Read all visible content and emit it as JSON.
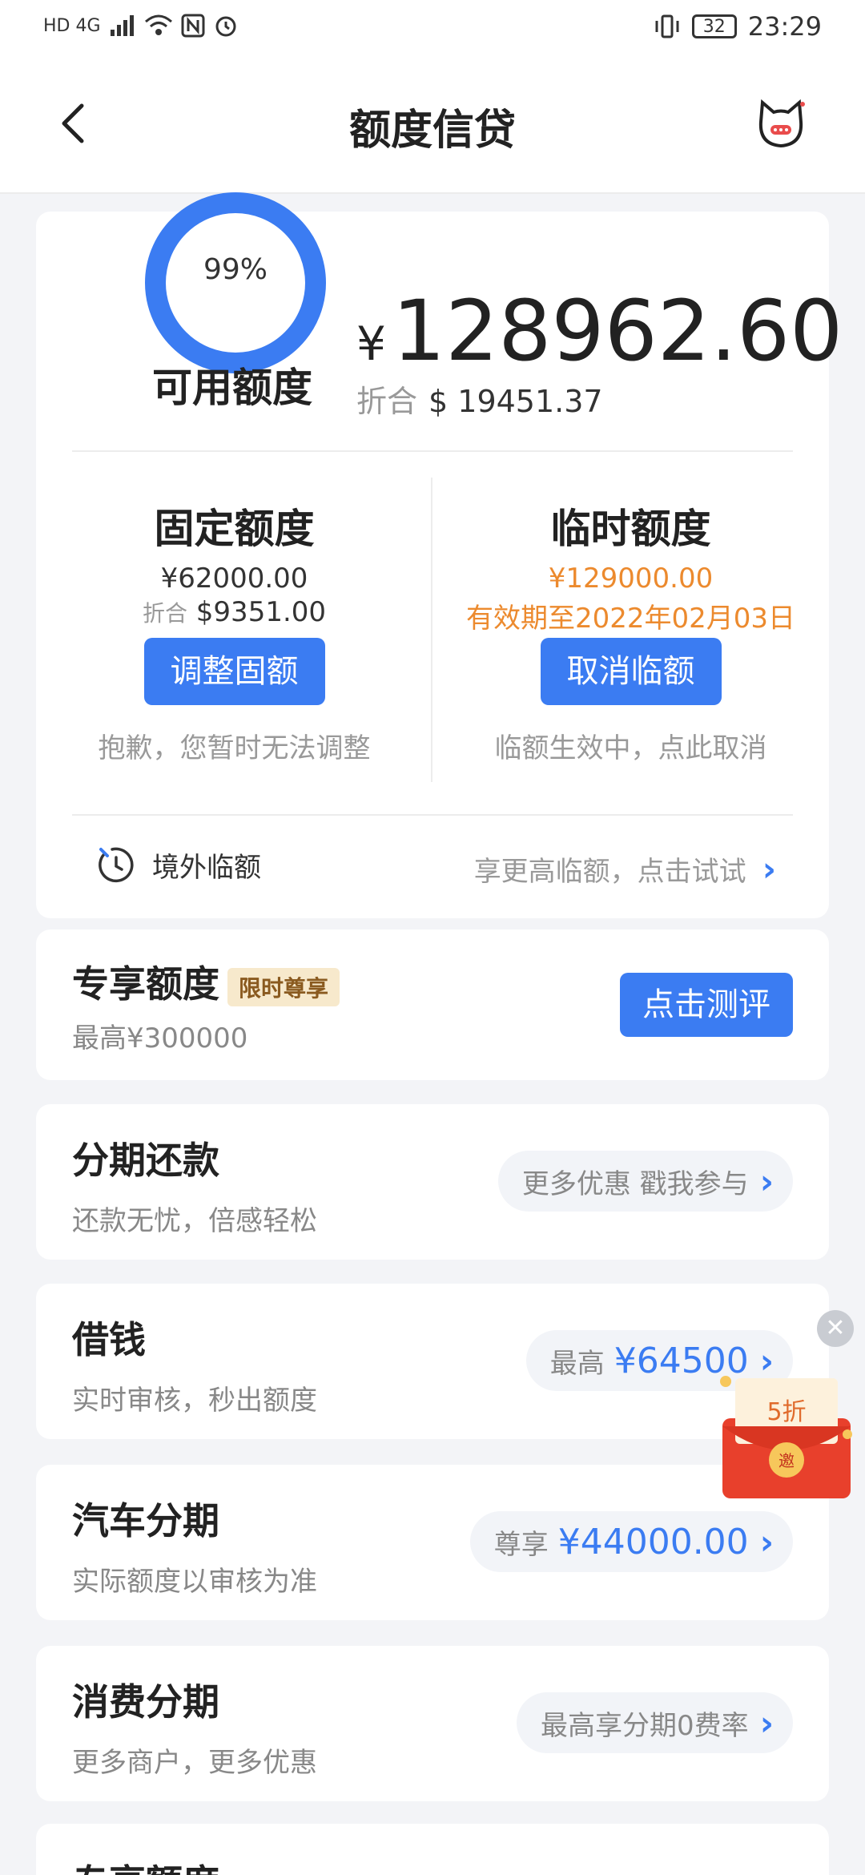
{
  "status_bar": {
    "network": "HD 4G",
    "battery": "32",
    "time": "23:29"
  },
  "header": {
    "title": "额度信贷"
  },
  "credit": {
    "percent": "99%",
    "percent_value": 0.99,
    "available_label": "可用额度",
    "currency_symbol": "¥",
    "available_amount": "128962.60",
    "converted_label": "折合",
    "converted_amount": "$ 19451.37",
    "fixed": {
      "title": "固定额度",
      "amount": "¥62000.00",
      "converted_label": "折合",
      "converted_amount": "$9351.00",
      "button": "调整固额",
      "note": "抱歉，您暂时无法调整"
    },
    "temporary": {
      "title": "临时额度",
      "amount": "¥129000.00",
      "validity": "有效期至2022年02月03日",
      "button": "取消临额",
      "note": "临额生效中，点此取消"
    },
    "overseas": {
      "label": "境外临额",
      "link": "享更高临额，点击试试"
    }
  },
  "exclusive": {
    "title": "专享额度",
    "tag": "限时尊享",
    "subtitle": "最高¥300000",
    "button": "点击测评"
  },
  "installment_repay": {
    "title": "分期还款",
    "subtitle": "还款无忧，倍感轻松",
    "pill": "更多优惠 戳我参与"
  },
  "borrow": {
    "title": "借钱",
    "subtitle": "实时审核，秒出额度",
    "pill_label": "最高",
    "pill_value": "¥64500"
  },
  "car": {
    "title": "汽车分期",
    "subtitle": "实际额度以审核为准",
    "pill_label": "尊享",
    "pill_value": "¥44000.00"
  },
  "consume": {
    "title": "消费分期",
    "subtitle": "更多商户，更多优惠",
    "pill": "最高享分期0费率"
  },
  "bottom_partial": {
    "title": "专享额度"
  },
  "promo": {
    "discount": "5折",
    "seal": "邀"
  },
  "colors": {
    "accent": "#3b7cf2",
    "orange": "#ec8a2e",
    "background": "#f3f4f7"
  }
}
